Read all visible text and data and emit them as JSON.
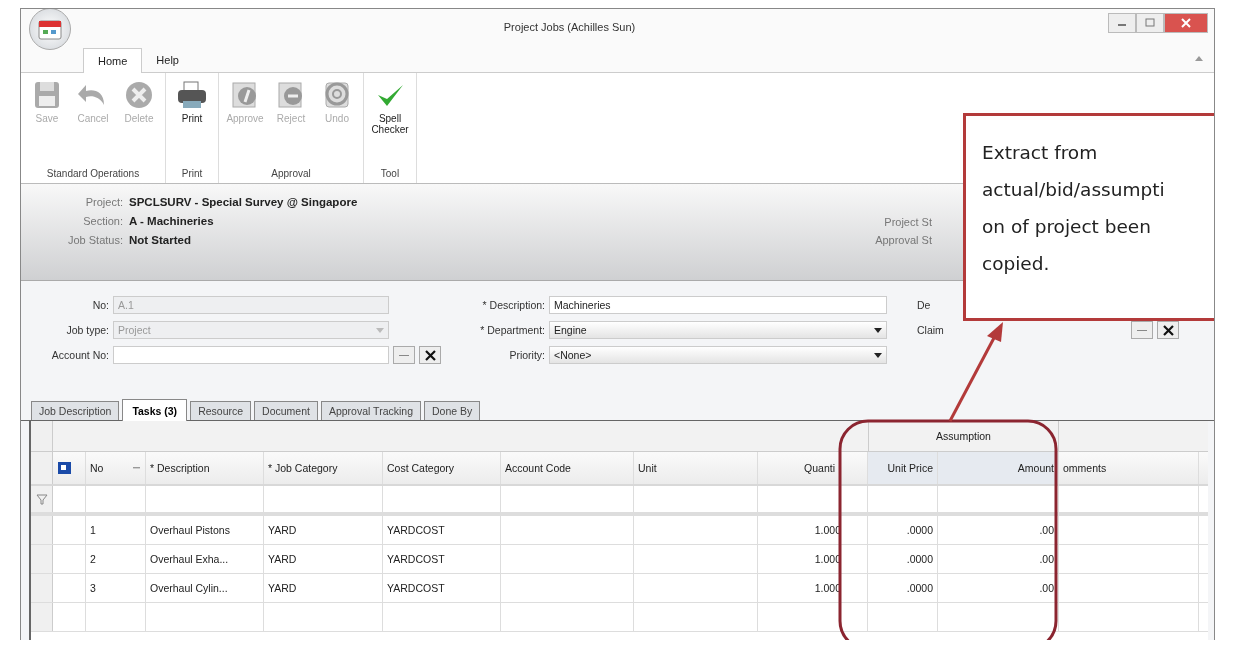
{
  "window": {
    "title": "Project Jobs (Achilles Sun)"
  },
  "ribbon": {
    "tabs": [
      {
        "label": "Home",
        "selected": true
      },
      {
        "label": "Help",
        "selected": false
      }
    ],
    "groups": [
      {
        "label": "Standard Operations",
        "buttons": [
          {
            "label": "Save",
            "kind": "save",
            "disabled": true
          },
          {
            "label": "Cancel",
            "kind": "cancel",
            "disabled": true
          },
          {
            "label": "Delete",
            "kind": "delete",
            "disabled": true
          }
        ]
      },
      {
        "label": "Print",
        "buttons": [
          {
            "label": "Print",
            "kind": "print",
            "disabled": false
          }
        ]
      },
      {
        "label": "Approval",
        "buttons": [
          {
            "label": "Approve",
            "kind": "approve",
            "disabled": true
          },
          {
            "label": "Reject",
            "kind": "reject",
            "disabled": true
          },
          {
            "label": "Undo",
            "kind": "undo",
            "disabled": true
          }
        ]
      },
      {
        "label": "Tool",
        "buttons": [
          {
            "label": "Spell Checker",
            "kind": "spell",
            "disabled": false
          }
        ]
      }
    ]
  },
  "header": {
    "fields": [
      {
        "label": "Project:",
        "value": "SPCLSURV - Special Survey @ Singapore"
      },
      {
        "label": "Section:",
        "value": "A - Machineries"
      },
      {
        "label": "Job Status:",
        "value": "Not Started"
      }
    ],
    "right_labels": [
      "Project St",
      "Approval St"
    ]
  },
  "form": {
    "columns": [
      [
        {
          "label": "No:",
          "value": "A.1",
          "kind": "text",
          "disabled": true
        },
        {
          "label": "Job type:",
          "value": "Project",
          "kind": "dropdown",
          "disabled": true
        },
        {
          "label": "Account No:",
          "kind": "lookup",
          "disabled": false
        }
      ],
      [
        {
          "label": "* Description:",
          "value": "Machineries",
          "kind": "text",
          "disabled": false
        },
        {
          "label": "* Department:",
          "value": "Engine",
          "kind": "dropdown",
          "disabled": false
        },
        {
          "label": "Priority:",
          "value": "<None>",
          "kind": "dropdown",
          "disabled": false
        }
      ],
      [
        {
          "label": "De",
          "kind": "none"
        },
        {
          "label": "Claim",
          "kind": "lookup"
        }
      ]
    ]
  },
  "detail_tabs": [
    {
      "label": "Job Description",
      "selected": false
    },
    {
      "label": "Tasks (3)",
      "selected": true
    },
    {
      "label": "Resource",
      "selected": false
    },
    {
      "label": "Document",
      "selected": false
    },
    {
      "label": "Approval Tracking",
      "selected": false
    },
    {
      "label": "Done By",
      "selected": false
    }
  ],
  "grid": {
    "band": "Assumption",
    "columns": [
      {
        "label": "No",
        "sorted": true,
        "banded": false
      },
      {
        "label": "* Description",
        "sorted": false,
        "banded": false
      },
      {
        "label": "* Job Category",
        "sorted": false,
        "banded": false
      },
      {
        "label": "Cost Category",
        "sorted": false,
        "banded": false
      },
      {
        "label": "Account Code",
        "sorted": false,
        "banded": false
      },
      {
        "label": "Unit",
        "sorted": false,
        "banded": false
      },
      {
        "label": "Quanti",
        "sorted": false,
        "banded": false
      },
      {
        "label": "Unit Price",
        "sorted": false,
        "banded": true
      },
      {
        "label": "Amount",
        "sorted": false,
        "banded": true
      },
      {
        "label": "omments",
        "sorted": false,
        "banded": false
      }
    ],
    "rows": [
      [
        "1",
        "Overhaul Pistons",
        "YARD",
        "YARDCOST",
        "",
        "",
        "1.000",
        ".0000",
        ".00",
        ""
      ],
      [
        "2",
        "Overhaul Exha...",
        "YARD",
        "YARDCOST",
        "",
        "",
        "1.000",
        ".0000",
        ".00",
        ""
      ],
      [
        "3",
        "Overhaul Cylin...",
        "YARD",
        "YARDCOST",
        "",
        "",
        "1.000",
        ".0000",
        ".00",
        ""
      ]
    ]
  },
  "annotation": {
    "lines": [
      "Extract from",
      "actual/bid/assumpti",
      "on of project been",
      "copied."
    ]
  }
}
